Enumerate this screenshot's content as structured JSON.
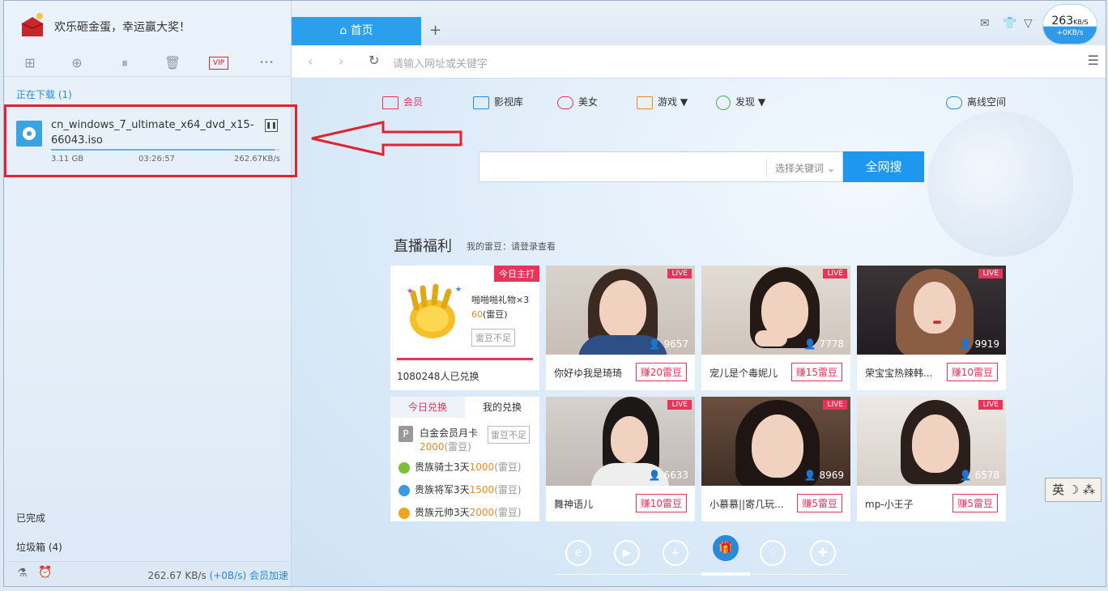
{
  "promo": {
    "text": "欢乐砸金蛋，幸运赢大奖！"
  },
  "left_toolbar": {
    "icons": [
      "add-icon",
      "download-icon",
      "pause-icon",
      "trash-icon",
      "vip-icon",
      "more-icon"
    ],
    "vip_label": "VIP",
    "more_label": "•••"
  },
  "downloading": {
    "label": "正在下载 (1)",
    "item": {
      "name": "cn_windows_7_ultimate_x64_dvd_x15-66043.iso",
      "size": "3.11 GB",
      "remaining": "03:26:57",
      "speed": "262.67KB/s",
      "progress": 0.98
    }
  },
  "completed_label": "已完成",
  "trash_label": "垃圾箱 (4)",
  "bottom": {
    "speed": "262.67 KB/s",
    "plus": "(+0B/s)",
    "vip": "会员加速"
  },
  "tabs": {
    "active": "首页",
    "add": "+"
  },
  "speed_ball": {
    "main": "263",
    "unit": "KB/S",
    "sub": "+0KB/s"
  },
  "address": {
    "placeholder": "请输入网址或关键字"
  },
  "nav": [
    {
      "label": "会员",
      "color": "#e8335a"
    },
    {
      "label": "影视库",
      "color": "#2a8ad9"
    },
    {
      "label": "美女",
      "color": "#e8335a"
    },
    {
      "label": "游戏",
      "color": "#f08a1d"
    },
    {
      "label": "发现",
      "color": "#3bb34a"
    },
    {
      "label": "离线空间",
      "color": "#2a8ad9"
    }
  ],
  "search": {
    "select_label": "选择关键词",
    "button": "全网搜"
  },
  "live": {
    "title": "直播福利",
    "sub": "我的雷豆：请登录查看"
  },
  "promo_card": {
    "tag": "今日主打",
    "gift_name": "啪啪啪礼物×3",
    "price": "60",
    "unit": "(雷豆)",
    "btn": "雷豆不足",
    "count": "1080248人已兑换"
  },
  "exchange": {
    "tab_today": "今日兑换",
    "tab_mine": "我的兑换",
    "rows": [
      {
        "name": "白金会员月卡",
        "amount": "2000",
        "unit": "(雷豆)",
        "btn": "雷豆不足"
      },
      {
        "name": "贵族骑士3天",
        "amount": "1000",
        "unit": "(雷豆)"
      },
      {
        "name": "贵族将军3天",
        "amount": "1500",
        "unit": "(雷豆)"
      },
      {
        "name": "贵族元帅3天",
        "amount": "2000",
        "unit": "(雷豆)"
      }
    ]
  },
  "streams": [
    {
      "name": "你好ゆ我是琦琦",
      "viewers": "9657",
      "earn": "赚20雷豆",
      "live": "LIVE"
    },
    {
      "name": "宠儿是个毒妮儿",
      "viewers": "7778",
      "earn": "赚15雷豆",
      "live": "LIVE"
    },
    {
      "name": "荣宝宝热辣韩...",
      "viewers": "9919",
      "earn": "赚10雷豆",
      "live": "LIVE"
    },
    {
      "name": "舞神语儿",
      "viewers": "6633",
      "earn": "赚10雷豆",
      "live": "LIVE"
    },
    {
      "name": "小慕慕||寄几玩...",
      "viewers": "8969",
      "earn": "赚5雷豆",
      "live": "LIVE"
    },
    {
      "name": "mp-小王子",
      "viewers": "6578",
      "earn": "赚5雷豆",
      "live": "LIVE"
    }
  ],
  "ime": {
    "label": "英 ☽ ⁂"
  }
}
